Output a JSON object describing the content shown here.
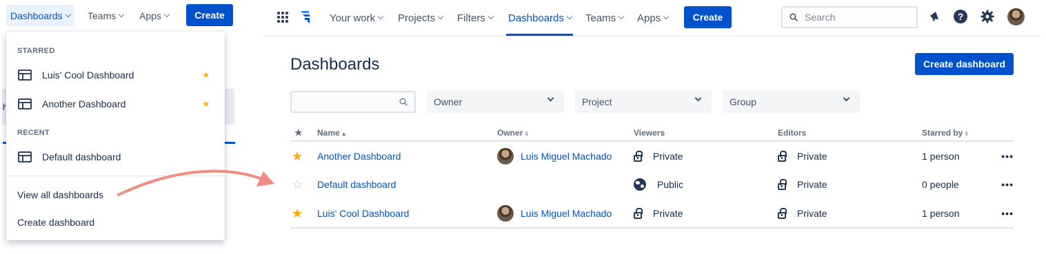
{
  "mini_nav": {
    "dashboards": "Dashboards",
    "teams": "Teams",
    "apps": "Apps",
    "create": "Create"
  },
  "background_peek": {
    "text": "h"
  },
  "dropdown": {
    "starred_heading": "STARRED",
    "starred": [
      {
        "label": "Luis' Cool Dashboard"
      },
      {
        "label": "Another Dashboard"
      }
    ],
    "recent_heading": "RECENT",
    "recent": [
      {
        "label": "Default dashboard"
      }
    ],
    "view_all": "View all dashboards",
    "create": "Create dashboard"
  },
  "topnav": {
    "your_work": "Your work",
    "projects": "Projects",
    "filters": "Filters",
    "dashboards": "Dashboards",
    "teams": "Teams",
    "apps": "Apps",
    "create": "Create",
    "search_placeholder": "Search",
    "help_glyph": "?"
  },
  "page": {
    "title": "Dashboards",
    "create_button": "Create dashboard"
  },
  "filters": {
    "search_value": "",
    "owner": "Owner",
    "project": "Project",
    "group": "Group"
  },
  "table": {
    "columns": {
      "star": "★",
      "name": "Name",
      "owner": "Owner",
      "viewers": "Viewers",
      "editors": "Editors",
      "starred_by": "Starred by"
    },
    "sort_glyph": "▲",
    "sort_neutral_glyph": "⇕",
    "rows": [
      {
        "starred": true,
        "name": "Another Dashboard",
        "owner": "Luis Miguel Machado",
        "viewers": "Private",
        "editors": "Private",
        "starred_by": "1 person",
        "more": "•••"
      },
      {
        "starred": false,
        "name": "Default dashboard",
        "owner": "",
        "viewers": "Public",
        "editors": "Private",
        "starred_by": "0 people",
        "more": "•••"
      },
      {
        "starred": true,
        "name": "Luis' Cool Dashboard",
        "owner": "Luis Miguel Machado",
        "viewers": "Private",
        "editors": "Private",
        "starred_by": "1 person",
        "more": "•••"
      }
    ]
  },
  "colors": {
    "primary": "#0052cc",
    "star": "#ffab00",
    "star_empty": "#c1c7d0",
    "arrow": "#f28b82",
    "text": "#172b4d"
  },
  "icons": {
    "star_filled": "★",
    "star_empty": "☆"
  }
}
